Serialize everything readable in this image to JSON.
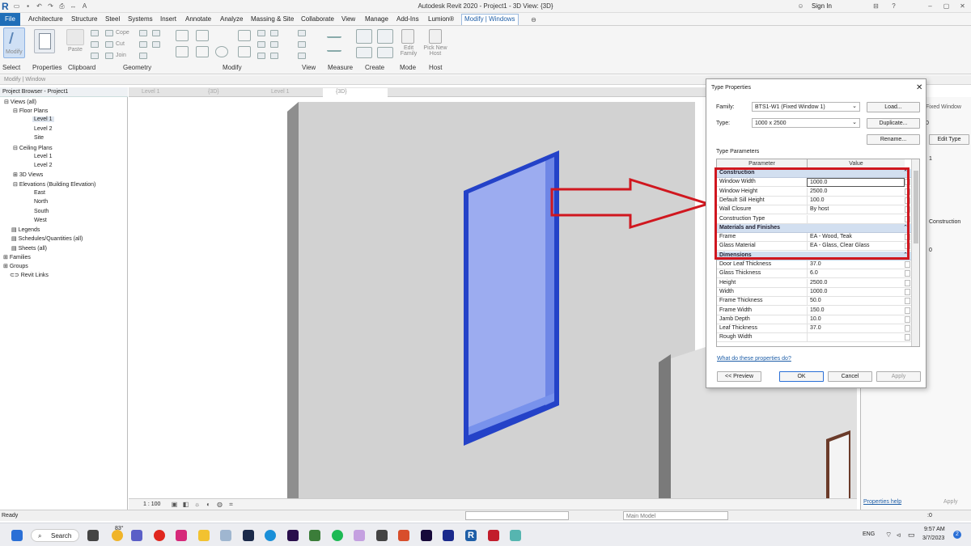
{
  "app": {
    "title": "Autodesk Revit 2020 - Project1 - 3D View: {3D}",
    "signin": "Sign In"
  },
  "menu": [
    "Architecture",
    "Structure",
    "Steel",
    "Systems",
    "Insert",
    "Annotate",
    "Analyze",
    "Massing & Site",
    "Collaborate",
    "View",
    "Manage",
    "Add-Ins",
    "Lumion®"
  ],
  "menu_file": "File",
  "menu_active": "Modify | Windows",
  "ribbon": {
    "modify_label": "Modify",
    "paste_label": "Paste",
    "cope_label": "Cope",
    "cut_label": "Cut",
    "join_label": "Join",
    "edit_family_label": "Edit Family",
    "pick_new_host_label": "Pick New Host",
    "groups": [
      "Select",
      "Properties",
      "Clipboard",
      "Geometry",
      "Modify",
      "View",
      "Measure",
      "Create",
      "Mode",
      "Host"
    ]
  },
  "context_label": "Modify | Window",
  "browser": {
    "title": "Project Browser - Project1",
    "items": [
      "Views (all)",
      "Floor Plans",
      "Level 1",
      "Level 2",
      "Site",
      "Ceiling Plans",
      "Level 1",
      "Level 2",
      "3D Views",
      "Elevations (Building Elevation)",
      "East",
      "North",
      "South",
      "West",
      "Legends",
      "Schedules/Quantities (all)",
      "Sheets (all)",
      "Families",
      "Groups",
      "Revit Links"
    ]
  },
  "tabs": [
    "Level 1",
    "{3D}",
    "Level 1",
    "{3D}"
  ],
  "scale": "1 : 100",
  "props": {
    "type_name": "Fixed Window",
    "edit_type": "Edit Type",
    "row1": "1",
    "row2": "0",
    "row3": "0",
    "construction": "Construction",
    "help": "Properties help",
    "apply": "Apply"
  },
  "status": {
    "ready": "Ready",
    "model": "Main Model",
    "filter": ":0"
  },
  "dialog": {
    "title": "Type Properties",
    "family_label": "Family:",
    "family_value": "BTS1-W1 (Fixed Window 1)",
    "type_label": "Type:",
    "type_value": "1000 x 2500",
    "load": "Load...",
    "duplicate": "Duplicate...",
    "rename": "Rename...",
    "type_params": "Type Parameters",
    "col_param": "Parameter",
    "col_value": "Value",
    "rows": [
      {
        "group": "Construction"
      },
      {
        "p": "Window Width",
        "v": "1000.0"
      },
      {
        "p": "Window Height",
        "v": "2500.0"
      },
      {
        "p": "Default Sill Height",
        "v": "100.0"
      },
      {
        "p": "Wall Closure",
        "v": "By host"
      },
      {
        "p": "Construction Type",
        "v": ""
      },
      {
        "group": "Materials and Finishes"
      },
      {
        "p": "Frame",
        "v": "EA - Wood, Teak"
      },
      {
        "p": "Glass Material",
        "v": "EA - Glass, Clear Glass"
      },
      {
        "group": "Dimensions"
      },
      {
        "p": "Door Leaf Thickness",
        "v": "37.0"
      },
      {
        "p": "Glass Thickness",
        "v": "6.0"
      },
      {
        "p": "Height",
        "v": "2500.0"
      },
      {
        "p": "Width",
        "v": "1000.0"
      },
      {
        "p": "Frame Thickness",
        "v": "50.0"
      },
      {
        "p": "Frame Width",
        "v": "150.0"
      },
      {
        "p": "Jamb Depth",
        "v": "10.0"
      },
      {
        "p": "Leaf Thickness",
        "v": "37.0"
      },
      {
        "p": "Rough Width",
        "v": ""
      }
    ],
    "help_link": "What do these properties do?",
    "preview": "<< Preview",
    "ok": "OK",
    "cancel": "Cancel",
    "apply": "Apply"
  },
  "taskbar": {
    "search": "Search",
    "weather": "83°",
    "lang": "ENG",
    "time": "9:57 AM",
    "date": "3/7/2023",
    "badge": "2"
  },
  "colors": {
    "accent": "#1f6eb8",
    "highlight": "#d0171f",
    "window_glass": "#9cacf0",
    "window_frame": "#2442c8"
  }
}
